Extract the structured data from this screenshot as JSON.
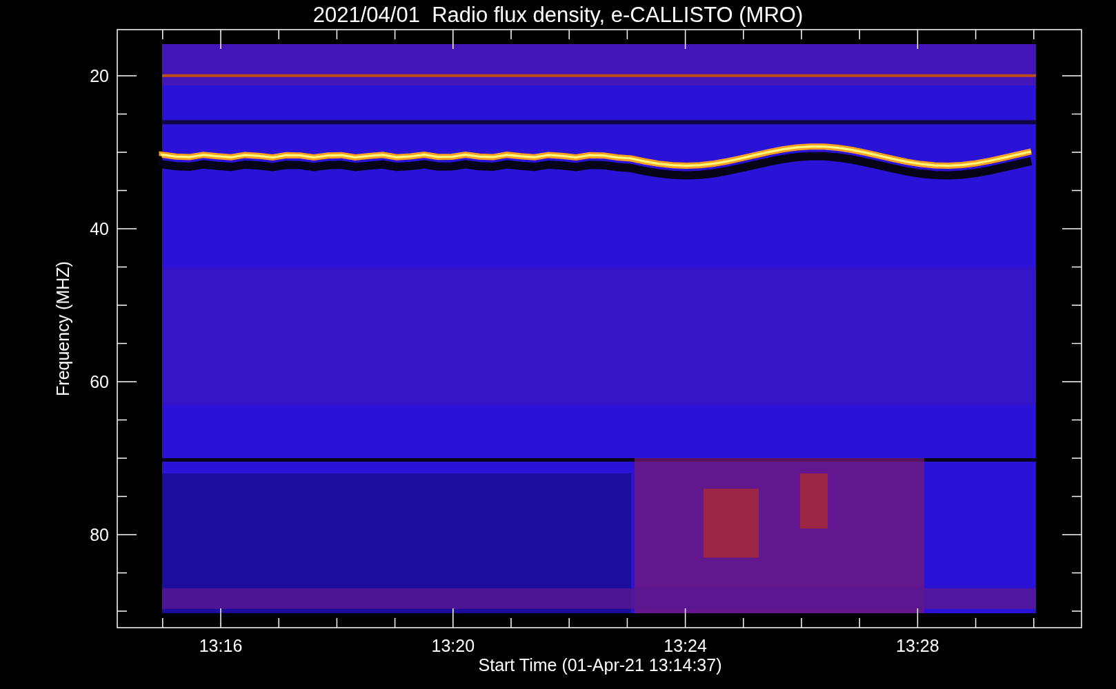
{
  "title": "2021/04/01  Radio flux density, e-CALLISTO (MRO)",
  "y_axis": {
    "label": "Frequency (MHZ)",
    "ticks": [
      "20",
      "40",
      "60",
      "80"
    ]
  },
  "x_axis": {
    "label": "Start Time (01-Apr-21 13:14:37)",
    "ticks": [
      "13:16",
      "13:20",
      "13:24",
      "13:28"
    ]
  }
}
